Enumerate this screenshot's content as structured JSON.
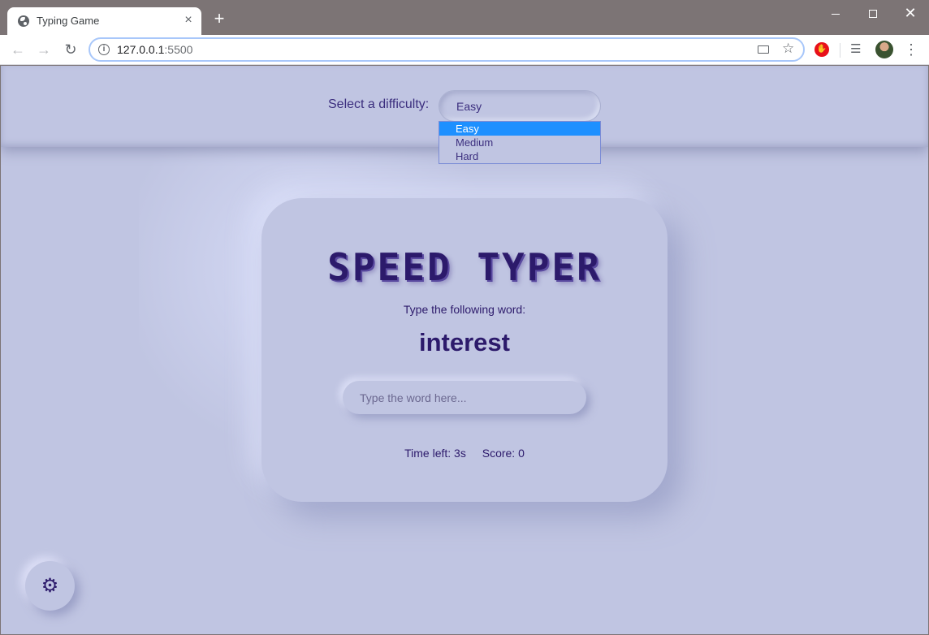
{
  "browser": {
    "tab_title": "Typing Game",
    "tab_close": "×",
    "new_tab": "+",
    "url_host": "127.0.0.1",
    "url_port": ":5500",
    "win_close": "✕"
  },
  "settings": {
    "difficulty_label": "Select a difficulty:",
    "selected": "Easy",
    "options": [
      "Easy",
      "Medium",
      "Hard"
    ]
  },
  "game": {
    "title": "SPEED TYPER",
    "prompt": "Type the following word:",
    "word": "interest",
    "input_placeholder": "Type the word here...",
    "time_left": "Time left: 3s",
    "score": "Score: 0"
  },
  "icons": {
    "settings": "gear-icon"
  }
}
